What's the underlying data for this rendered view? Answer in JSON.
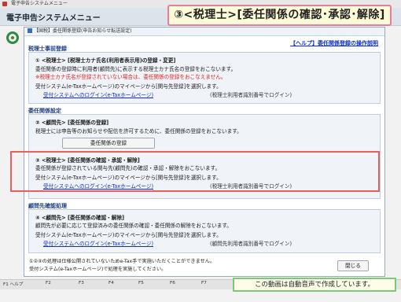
{
  "window_title": "電子申告システムメニュー",
  "app_title": "電子申告システムメニュー",
  "callout": "③<税理士>[委任関係の確認･承認･解除]",
  "dialog": {
    "title": "【国税】委任関係登録(申告お知らせ転送設定)",
    "help_link": "【ヘルプ】委任関係登録の操作説明",
    "sections": {
      "pre_register": {
        "heading": "税理士事前登録",
        "line1": "① <税理士>  [税理士カナ氏名(利用者表示用)の登録・変更]",
        "line2": "委任関係の登録時に利用者(顧問先)に表示する税理士カナ氏名の登録をおこないます。",
        "line3": "※税理士カナ氏名が登録されていない場合は、委任関係の登録をおこなえません。",
        "line4": "受付システム(e-Taxホームページ)のマイページから[関与先登録]を選択します。",
        "link": "受付システムへのログイン(e-Taxホームページ)",
        "note": "(税理士利用者識別番号でログイン)"
      },
      "delegate_setting": {
        "heading": "委任関係設定",
        "line1": "② <顧問先>  [委任関係の登録]",
        "line2": "税理士には申告等のお知らせや配信を許可するために、委任関係の登録をおこないます。",
        "button": "委任関係の登録",
        "confirm_title": "③ <税理士>  [委任関係の確認・承認・解除]",
        "confirm_line": "委任関係が登録されている関与先(顧問先)の確認・承認・解除をおこないます。",
        "confirm_line2": "受付システム(e-Taxホームページ)のマイページから[関与先登録]を選択します。",
        "confirm_link": "受付システムへのログイン(e-Taxホームページ)",
        "confirm_note": "(税理士利用者識別番号でログイン)"
      },
      "client_process": {
        "heading": "顧問先確認処理",
        "line1": "④ <顧問先>  [委任関係の確認・解除]",
        "line2": "顧問先が必要に応じて登録済みの委任関係の確認・委任関係の解除をおこないます。",
        "line3": "受付システム(e-Taxホームページ)のマイページから[関与先登録]を選択します。",
        "link": "受付システムへのログイン(e-Taxホームページ)",
        "note": "(顧問先利用者識別番号でログイン)"
      }
    },
    "footer_line1": "①②④の処理は仕様公開されていないためe-Tax手で実施いただくことができません。",
    "footer_line2": "受付システム(e-Taxホームページ)で処理を実施してください。",
    "close_button": "閉じる"
  },
  "fkeys": [
    "F1 ヘルプ",
    "F2",
    "F3",
    "F4",
    "F5",
    "F6",
    "F7"
  ],
  "auto_voice": "この動画は自動音声で作成しています。"
}
